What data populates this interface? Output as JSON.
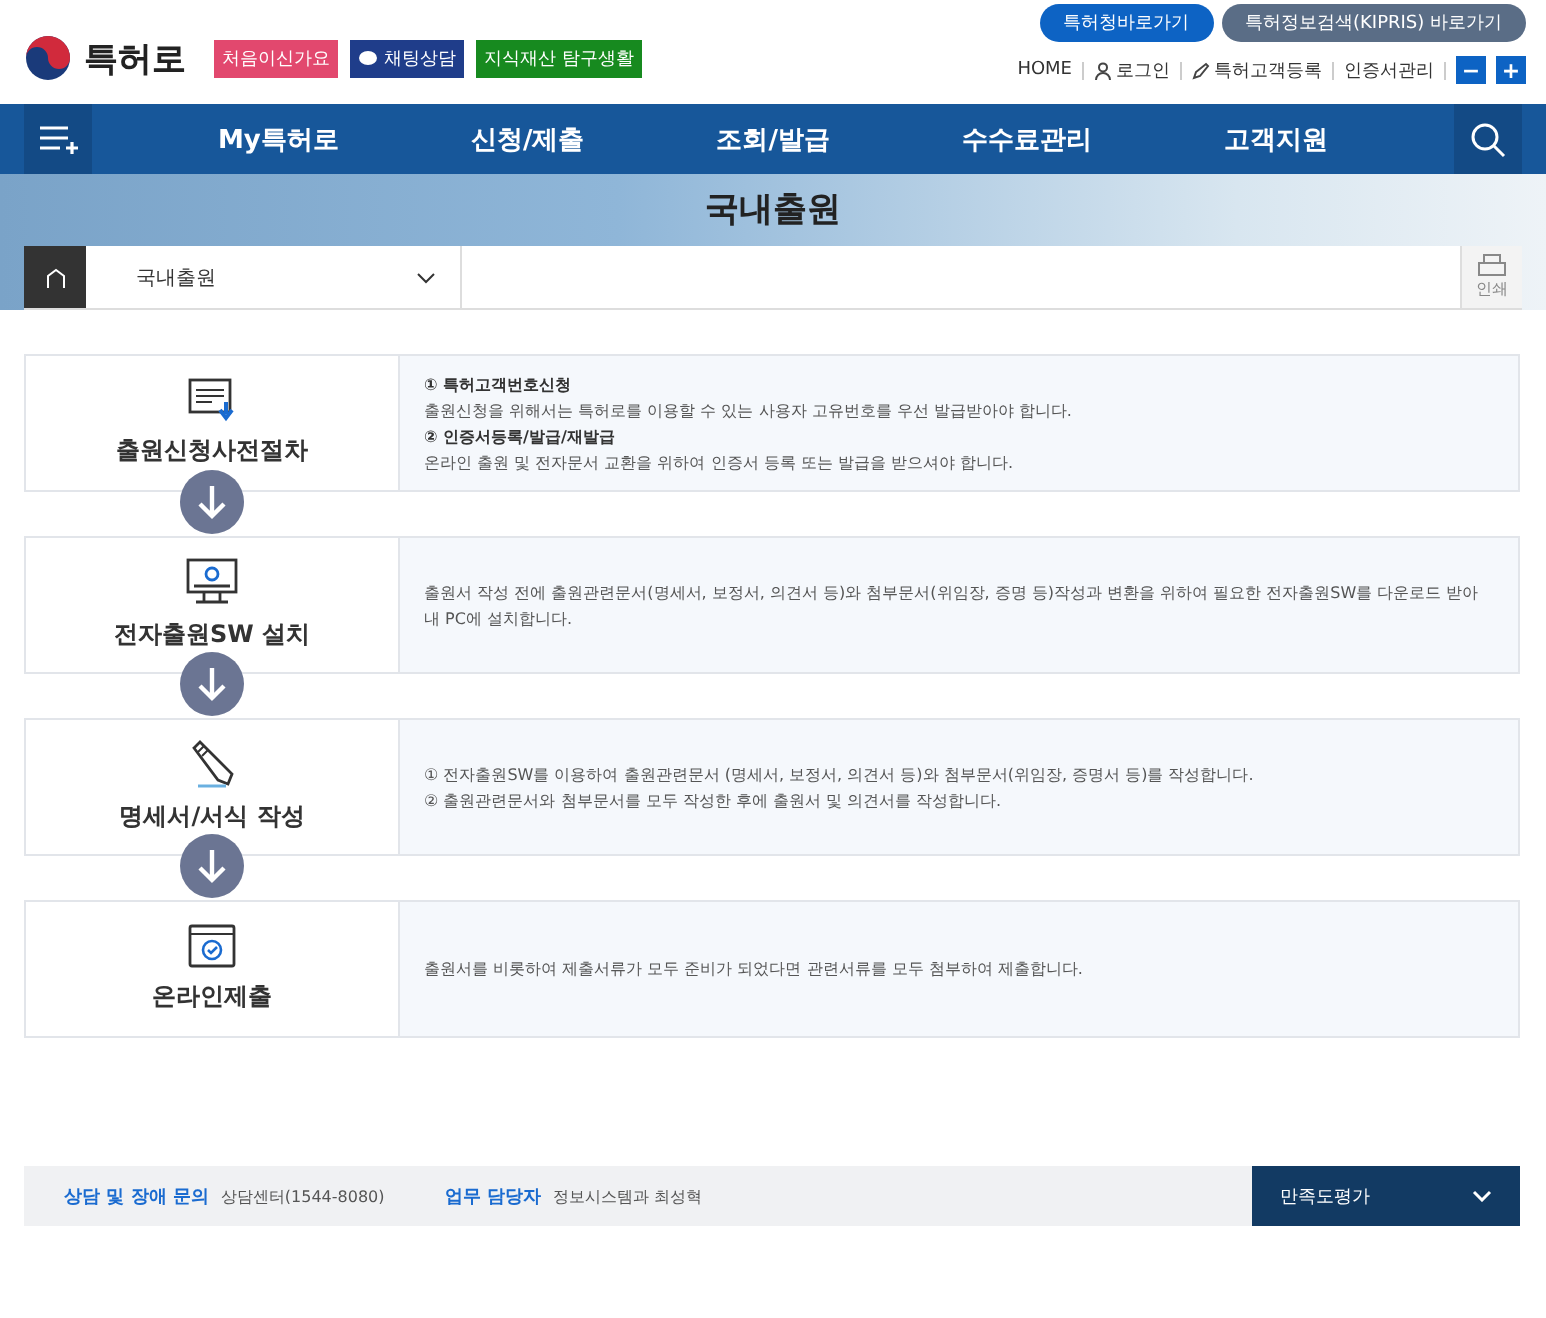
{
  "header": {
    "logo": "특허로",
    "badges": [
      {
        "label": "처음이신가요",
        "color": "#e2486e",
        "kind": "plain"
      },
      {
        "label": "채팅상담",
        "color": "#1f3d8a",
        "kind": "chat"
      },
      {
        "label": "지식재산 탐구생활",
        "color": "#178a1f",
        "kind": "plain"
      }
    ],
    "top_buttons": [
      {
        "label": "특허청바로가기",
        "color": "#0d63c4"
      },
      {
        "label": "특허정보검색(KIPRIS) 바로가기",
        "color": "#5a6d86"
      }
    ],
    "util_links": [
      {
        "label": "HOME",
        "kind": "plain"
      },
      {
        "label": "로그인",
        "kind": "user"
      },
      {
        "label": "특허고객등록",
        "kind": "pencil"
      },
      {
        "label": "인증서관리",
        "kind": "plain"
      }
    ],
    "zoom_buttons": [
      "−",
      "+"
    ]
  },
  "nav": {
    "items": [
      "My특허로",
      "신청/제출",
      "조회/발급",
      "수수료관리",
      "고객지원"
    ]
  },
  "banner": {
    "title": "국내출원"
  },
  "breadcrumb": {
    "current": "국내출원",
    "print_label": "인쇄"
  },
  "steps": [
    {
      "title": "출원신청사전절차",
      "kind": "document",
      "lines": [
        {
          "text": "① 특허고객번호신청",
          "kind": "heading"
        },
        {
          "text": "출원신청을 위해서는 특허로를 이용할 수 있는 사용자 고유번호를 우선 발급받아야 합니다.",
          "kind": "text"
        },
        {
          "text": "② 인증서등록/발급/재발급",
          "kind": "heading"
        },
        {
          "text": "온라인 출원 및 전자문서 교환을 위하여 인증서 등록 또는 발급을 받으셔야 합니다.",
          "kind": "text"
        }
      ]
    },
    {
      "title": "전자출원SW 설치",
      "kind": "monitor",
      "lines": [
        {
          "text": "출원서 작성 전에 출원관련문서(명세서, 보정서, 의견서 등)와 첨부문서(위임장, 증명 등)작성과 변환을 위하여 필요한 전자출원SW를 다운로드 받아 내 PC에 설치합니다.",
          "kind": "text"
        }
      ]
    },
    {
      "title": "명세서/서식 작성",
      "kind": "pencil",
      "lines": [
        {
          "text": "① 전자출원SW를 이용하여 출원관련문서 (명세서, 보정서, 의견서 등)와 첨부문서(위임장, 증명서 등)를 작성합니다.",
          "kind": "text"
        },
        {
          "text": "② 출원관련문서와 첨부문서를 모두 작성한 후에 출원서 및 의견서를 작성합니다.",
          "kind": "text"
        }
      ]
    },
    {
      "title": "온라인제출",
      "kind": "window",
      "lines": [
        {
          "text": "출원서를 비롯하여 제출서류가 모두 준비가 되었다면 관련서류를 모두 첨부하여 제출합니다.",
          "kind": "text"
        }
      ]
    }
  ],
  "footer": {
    "items": [
      {
        "label": "상담 및 장애 문의",
        "value": "상담센터(1544-8080)"
      },
      {
        "label": "업무 담당자",
        "value": "정보시스템과 최성혁"
      }
    ],
    "survey": "만족도평가"
  }
}
